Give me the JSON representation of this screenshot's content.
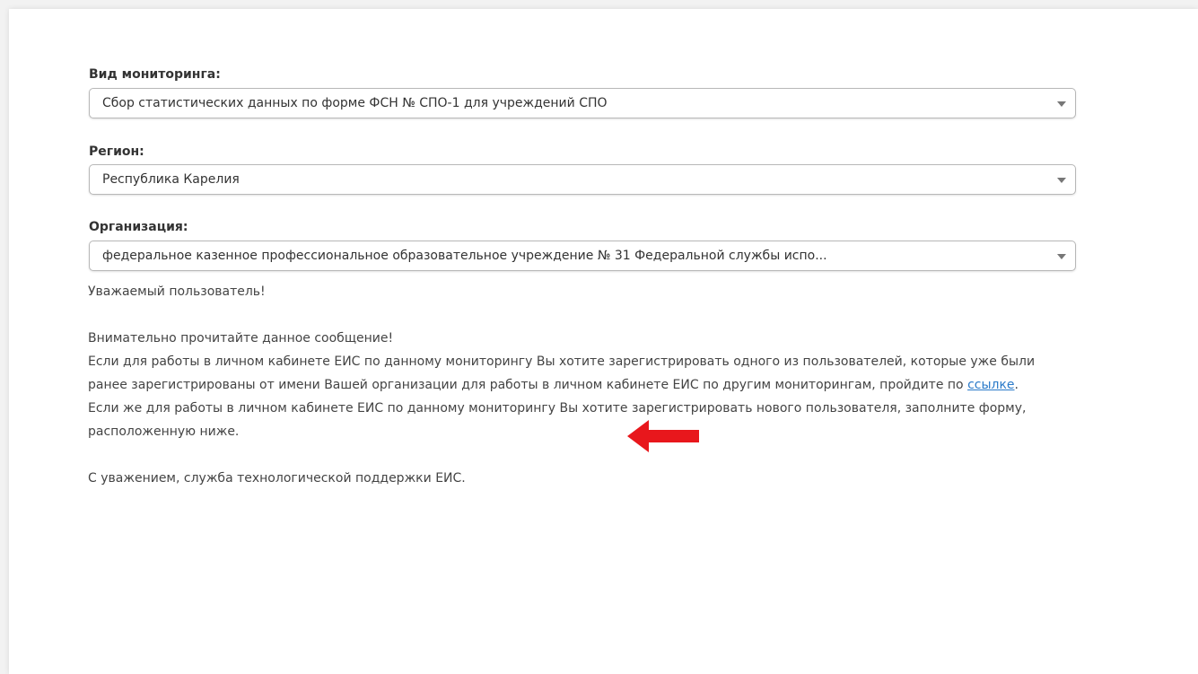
{
  "form": {
    "monitoring": {
      "label": "Вид мониторинга:",
      "value": "Сбор статистических данных по форме ФСН № СПО-1 для учреждений СПО"
    },
    "region": {
      "label": "Регион:",
      "value": "Республика Карелия"
    },
    "organization": {
      "label": "Организация:",
      "value": "федеральное казенное профессиональное образовательное учреждение № 31 Федеральной службы испо..."
    }
  },
  "message": {
    "greeting": "Уважаемый пользователь!",
    "line_attention": "Внимательно прочитайте данное сообщение!",
    "paragraph_existing_before_link": "Если для работы в личном кабинете ЕИС по данному мониторингу Вы хотите зарегистрировать одного из пользователей, которые уже были ранее зарегистрированы от имени Вашей организации для работы в личном кабинете ЕИС по другим мониторингам, пройдите по ",
    "link_text": "ссылке",
    "paragraph_existing_after_link": ".",
    "paragraph_new": "Если же для работы в личном кабинете ЕИС по данному мониторингу Вы хотите зарегистрировать нового пользователя, заполните форму, расположенную ниже.",
    "signature": "С уважением, служба технологической поддержки ЕИС."
  },
  "colors": {
    "link": "#2a7ac9",
    "arrow": "#e8171c"
  },
  "icons": {
    "annotation": "red-arrow-left-icon",
    "dropdown": "chevron-down-icon"
  }
}
